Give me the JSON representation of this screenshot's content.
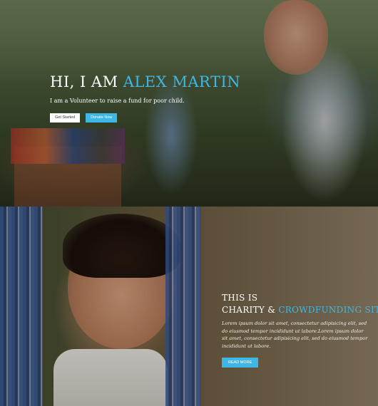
{
  "hero": {
    "title_prefix": "HI, I AM ",
    "title_name": "ALEX MARTIN",
    "subtitle": "I am a Volunteer to raise a fund for poor child.",
    "buttons": {
      "get_started": "Get Started",
      "donate_now": "Donate Now"
    }
  },
  "charity": {
    "line1": "THIS IS",
    "line2_prefix": "CHARITY & ",
    "line2_accent": "CROWDFUNDING SITE",
    "body": "Lorem ipsum dolor sit amet, consectetur adipisicing elit, sed do eiusmod tempor incididunt ut labore.Lorem ipsum dolor sit amet, consectetur adipisicing elit, sed do eiusmod tempor incididunt ut labore.",
    "button": "READ MORE"
  },
  "colors": {
    "accent": "#3fb7e6",
    "white": "#ffffff"
  }
}
